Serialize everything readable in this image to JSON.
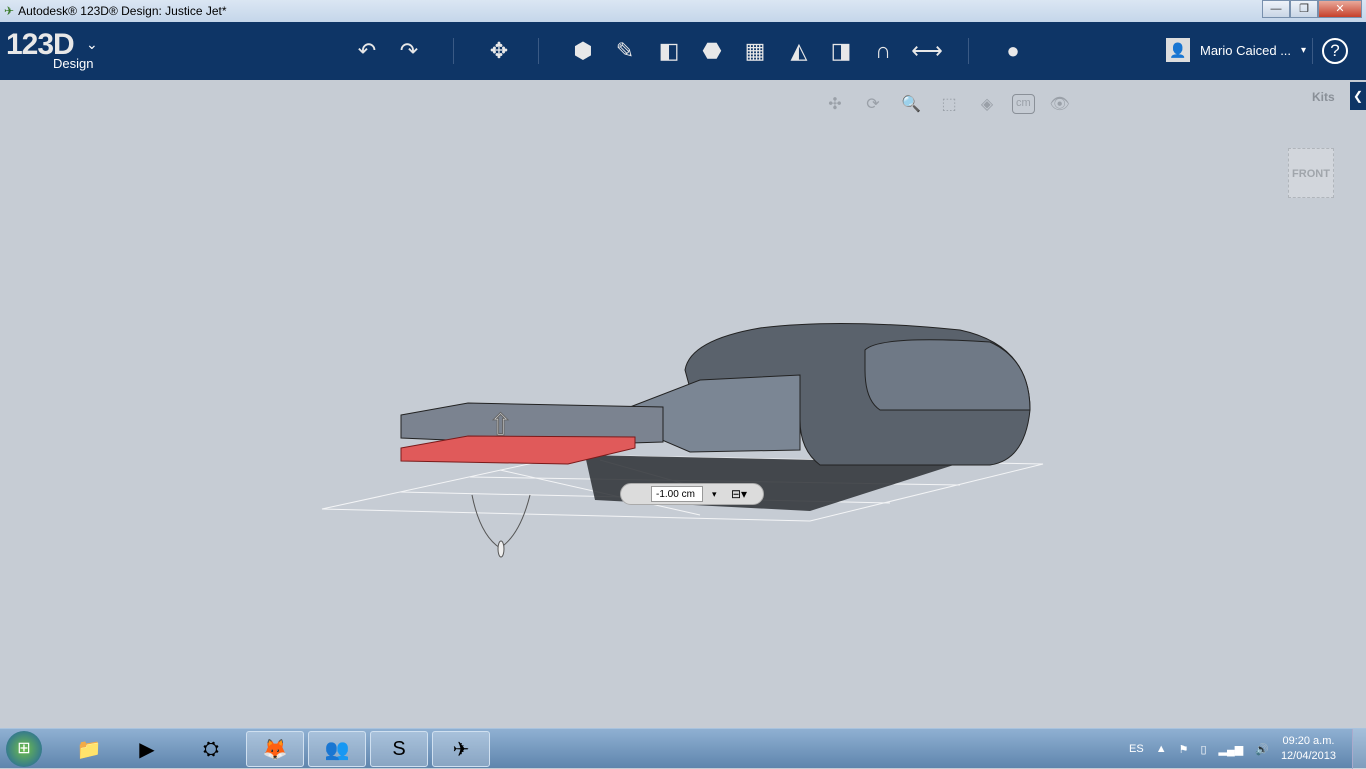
{
  "window": {
    "title": "Autodesk® 123D® Design: Justice Jet*",
    "minimize": "—",
    "maximize": "❐",
    "close": "✕"
  },
  "app": {
    "logo": "123D",
    "logo_sub": "Design"
  },
  "toolbar": {
    "tools": [
      {
        "name": "undo",
        "glyph": "↶"
      },
      {
        "name": "redo",
        "glyph": "↷"
      },
      {
        "name": "transform",
        "glyph": "✥"
      },
      {
        "name": "primitives",
        "glyph": "⬢"
      },
      {
        "name": "sketch",
        "glyph": "✎"
      },
      {
        "name": "construct",
        "glyph": "◧"
      },
      {
        "name": "modify",
        "glyph": "⬣"
      },
      {
        "name": "pattern",
        "glyph": "▦"
      },
      {
        "name": "grouping",
        "glyph": "◭"
      },
      {
        "name": "combine",
        "glyph": "◨"
      },
      {
        "name": "snap",
        "glyph": "∩"
      },
      {
        "name": "measure",
        "glyph": "⟷"
      },
      {
        "name": "material",
        "glyph": "●"
      }
    ]
  },
  "user": {
    "name": "Mario Caiced ...",
    "dropdown": "▾"
  },
  "help": "?",
  "nav": {
    "pan": "✣",
    "orbit": "⟳",
    "zoom": "🔍",
    "fit": "⬚",
    "view_mode": "◈",
    "units": "cm",
    "visibility": "👁"
  },
  "kits": {
    "label": "Kits",
    "toggle": "❮"
  },
  "viewcube": {
    "label": "FRONT"
  },
  "dimension": {
    "value": "-1.00 cm"
  },
  "taskbar": {
    "start": "⊞",
    "apps": [
      {
        "name": "explorer",
        "glyph": "📁"
      },
      {
        "name": "media-player",
        "glyph": "▶"
      },
      {
        "name": "app",
        "glyph": "⛭"
      },
      {
        "name": "firefox",
        "glyph": "🦊"
      },
      {
        "name": "messenger",
        "glyph": "👥"
      },
      {
        "name": "skype",
        "glyph": "S"
      },
      {
        "name": "123d-design",
        "glyph": "✈"
      }
    ]
  },
  "tray": {
    "language": "ES",
    "time": "09:20 a.m.",
    "date": "12/04/2013"
  },
  "colors": {
    "topbar": "#0e3566",
    "viewport": "#c6ccd4",
    "selection": "#e05a5a"
  }
}
